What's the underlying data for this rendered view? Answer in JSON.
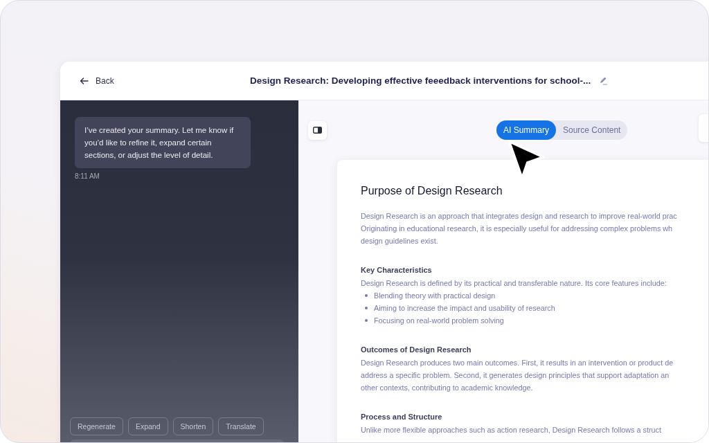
{
  "header": {
    "back_label": "Back",
    "title": "Design Research: Developing effective feeedback interventions for school-..."
  },
  "chat": {
    "messages": [
      {
        "text": "I’ve created your summary. Let me know if you’d like to refine it, expand certain sections, or adjust the level of detail.",
        "time": "8:11 AM"
      }
    ],
    "actions": [
      "Regenerate",
      "Expand",
      "Shorten",
      "Translate"
    ]
  },
  "view_tabs": [
    {
      "label": "AI Summary",
      "selected": true
    },
    {
      "label": "Source Content",
      "selected": false
    }
  ],
  "document": {
    "title": "Purpose of Design Research",
    "blocks": [
      {
        "kind": "paragraph",
        "lines": [
          "Design Research is an approach that integrates design and research to improve real-world prac",
          "Originating in educational research, it is especially useful for addressing complex problems wh",
          "design guidelines exist."
        ]
      },
      {
        "kind": "heading",
        "text": "Key Characteristics"
      },
      {
        "kind": "paragraph",
        "lines": [
          "Design Research is defined by its practical and transferable nature. Its core features include:"
        ]
      },
      {
        "kind": "bullets",
        "items": [
          "Blending theory with practical design",
          "Aiming to increase the impact and usability of research",
          "Focusing on real-world problem solving"
        ]
      },
      {
        "kind": "heading",
        "text": "Outcomes of Design Research"
      },
      {
        "kind": "paragraph",
        "lines": [
          "Design Research produces two main outcomes. First, it results in an intervention or product de",
          "address a specific problem. Second, it generates design principles that support adaptation an",
          "other contexts, contributing to academic knowledge."
        ]
      },
      {
        "kind": "heading",
        "text": "Process and Structure"
      },
      {
        "kind": "paragraph",
        "lines": [
          "Unlike more flexible approaches such as action research, Design Research follows a struct"
        ]
      }
    ]
  }
}
